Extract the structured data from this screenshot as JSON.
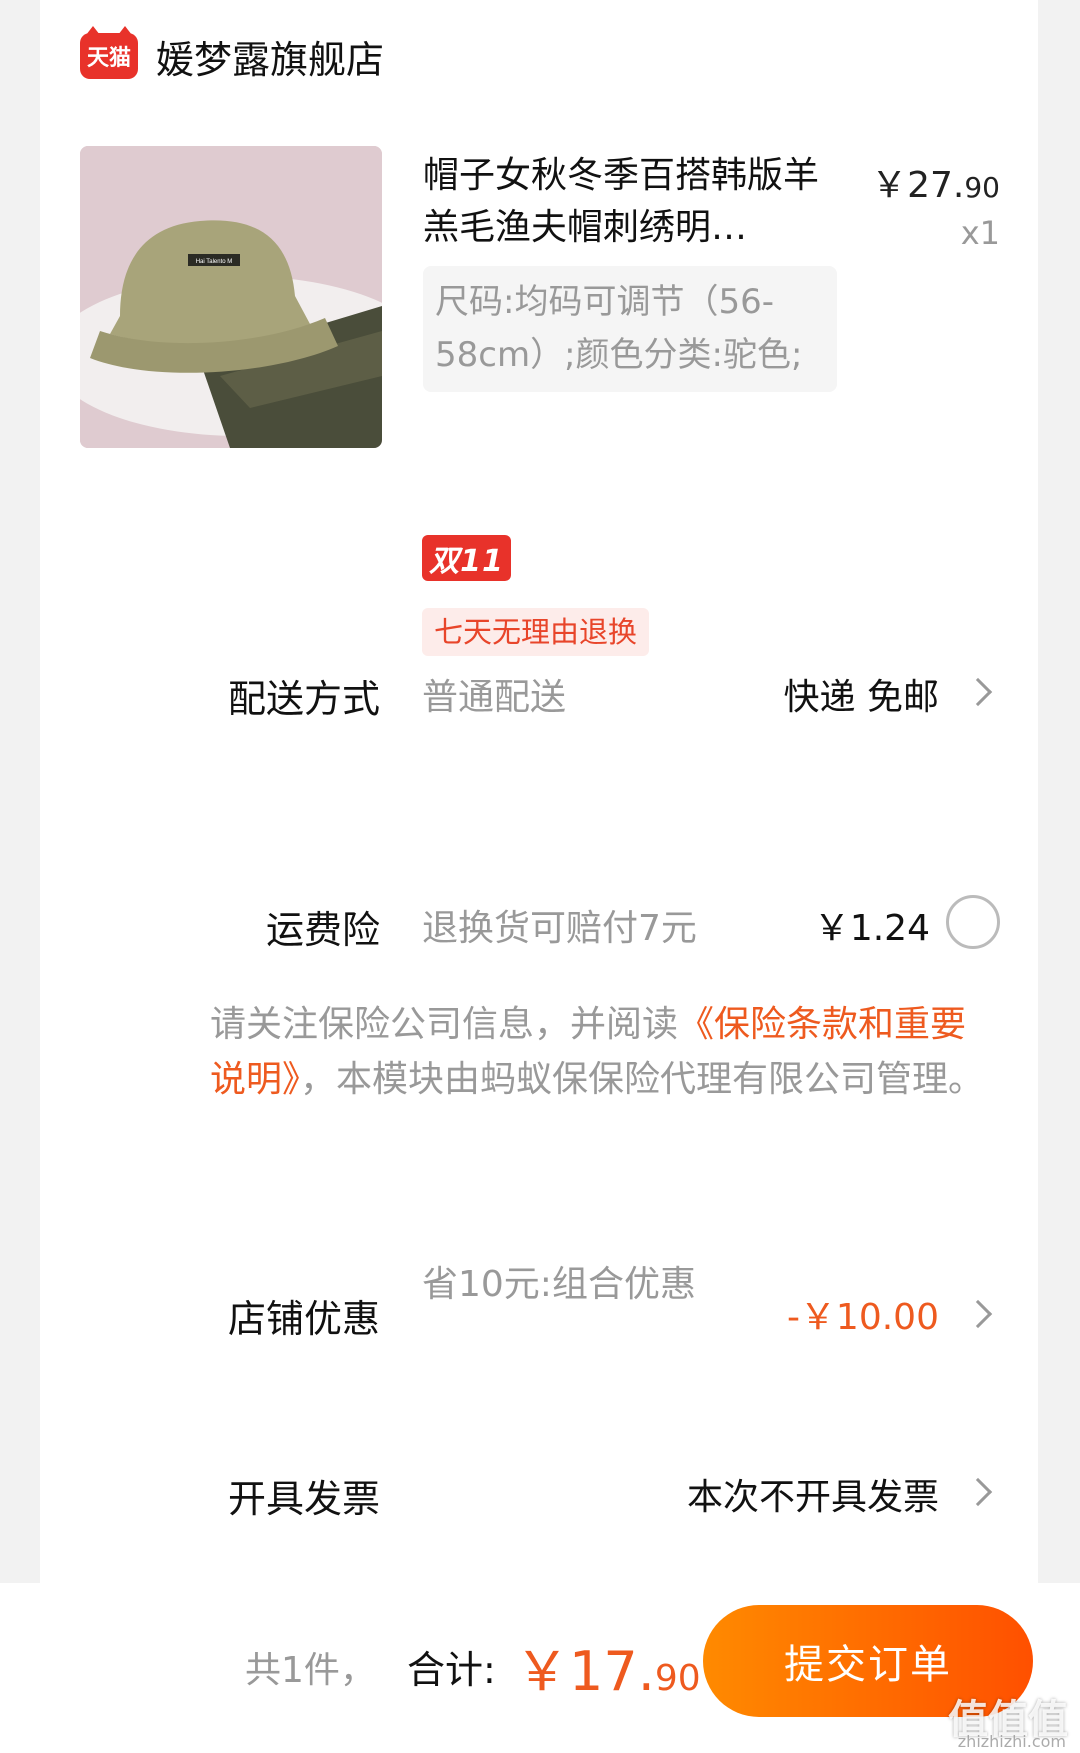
{
  "store": {
    "badge": "天猫",
    "name": "媛梦露旗舰店"
  },
  "product": {
    "title": "帽子女秋冬季百搭韩版羊羔毛渔夫帽刺绣明…",
    "price_int": "￥27.",
    "price_dec": "90",
    "qty": "x1",
    "sku": "尺码:均码可调节（56-58cm）;颜色分类:驼色;",
    "image_label": "Hai Talento M",
    "tag_1111": "双11",
    "tag_return": "七天无理由退换"
  },
  "delivery": {
    "label": "配送方式",
    "desc": "普通配送",
    "value": "快递 免邮"
  },
  "insurance": {
    "label": "运费险",
    "desc": "退换货可赔付7元",
    "value": "￥1.24"
  },
  "notice": {
    "pre": "请关注保险公司信息，并阅读",
    "link": "《保险条款和重要说明》",
    "post": "，本模块由蚂蚁保保险代理有限公司管理。"
  },
  "discount": {
    "label": "店铺优惠",
    "desc": "省10元:组合优惠",
    "value": "-￥10.00"
  },
  "invoice": {
    "label": "开具发票",
    "value": "本次不开具发票"
  },
  "footer": {
    "count": "共1件，",
    "total_label": "合计:",
    "total_int": "￥17.",
    "total_dec": "90",
    "submit": "提交订单",
    "watermark": "值值值",
    "watermark_url": "zhizhizhi.com"
  },
  "colors": {
    "accent": "#ee5a1f",
    "tmall_red": "#e8322a"
  }
}
